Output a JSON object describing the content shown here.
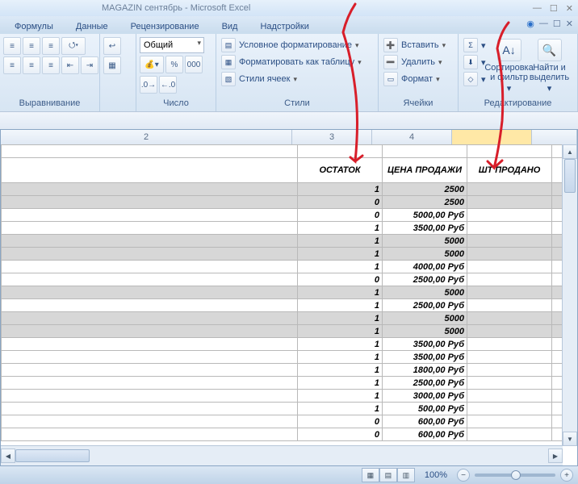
{
  "window": {
    "title": "MAGAZIN сентябрь - Microsoft Excel"
  },
  "tabs": {
    "formulas": "Формулы",
    "data": "Данные",
    "review": "Рецензирование",
    "view": "Вид",
    "addins": "Надстройки"
  },
  "ribbon": {
    "alignment": {
      "label": "Выравнивание"
    },
    "number": {
      "label": "Число",
      "format": "Общий"
    },
    "styles": {
      "label": "Стили",
      "cond": "Условное форматирование",
      "table": "Форматировать как таблицу",
      "cell": "Стили ячеек"
    },
    "cells": {
      "label": "Ячейки",
      "insert": "Вставить",
      "delete": "Удалить",
      "format": "Формат"
    },
    "editing": {
      "label": "Редактирование",
      "sort": "Сортировка и фильтр",
      "find": "Найти и выделить"
    }
  },
  "colHeaders": [
    "2",
    "3",
    "4"
  ],
  "tableHeaders": {
    "c3": "ОСТАТОК",
    "c4": "ЦЕНА ПРОДАЖИ",
    "c5": "ШТ ПРОДАНО"
  },
  "rows": [
    {
      "c3": "1",
      "c4": "2500",
      "shade": true
    },
    {
      "c3": "0",
      "c4": "2500",
      "shade": true
    },
    {
      "c3": "0",
      "c4": "5000,00 Руб",
      "shade": false
    },
    {
      "c3": "1",
      "c4": "3500,00 Руб",
      "shade": false
    },
    {
      "c3": "1",
      "c4": "5000",
      "shade": true
    },
    {
      "c3": "1",
      "c4": "5000",
      "shade": true
    },
    {
      "c3": "1",
      "c4": "4000,00 Руб",
      "shade": false
    },
    {
      "c3": "0",
      "c4": "2500,00 Руб",
      "shade": false
    },
    {
      "c3": "1",
      "c4": "5000",
      "shade": true
    },
    {
      "c3": "1",
      "c4": "2500,00 Руб",
      "shade": false
    },
    {
      "c3": "1",
      "c4": "5000",
      "shade": true
    },
    {
      "c3": "1",
      "c4": "5000",
      "shade": true
    },
    {
      "c3": "1",
      "c4": "3500,00 Руб",
      "shade": false
    },
    {
      "c3": "1",
      "c4": "3500,00 Руб",
      "shade": false
    },
    {
      "c3": "1",
      "c4": "1800,00 Руб",
      "shade": false
    },
    {
      "c3": "1",
      "c4": "2500,00 Руб",
      "shade": false
    },
    {
      "c3": "1",
      "c4": "3000,00 Руб",
      "shade": false
    },
    {
      "c3": "1",
      "c4": "500,00 Руб",
      "shade": false
    },
    {
      "c3": "0",
      "c4": "600,00 Руб",
      "shade": false
    },
    {
      "c3": "0",
      "c4": "600,00 Руб",
      "shade": false
    }
  ],
  "status": {
    "zoom": "100%"
  }
}
